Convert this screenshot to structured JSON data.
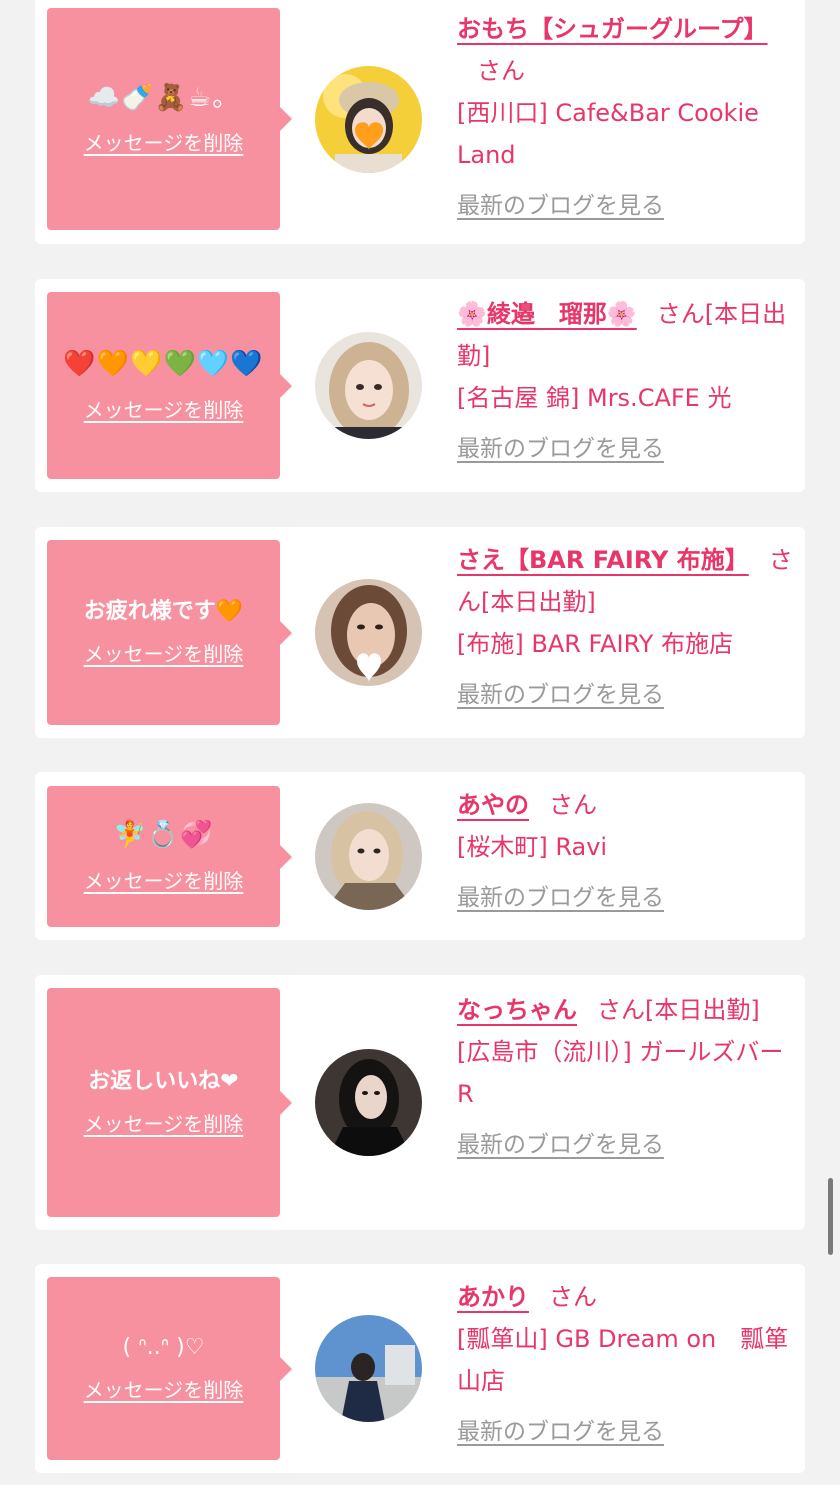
{
  "delete_label": "メッセージを削除",
  "blog_label": "最新のブログを見る",
  "accent_color": "#e8366a",
  "bubble_color": "#f7909f",
  "cards": [
    {
      "message": "☁️🍼🧸☕。",
      "name": "おもち【シュガーグループ】",
      "suffix": "さん",
      "shop": "[西川口] Cafe&Bar Cookie Land"
    },
    {
      "message": "❤️🧡💛💚🩵💙",
      "name": "🌸綾邉　瑠那🌸",
      "suffix": "さん[本日出勤]",
      "shop": "[名古屋 錦] Mrs.CAFE 光"
    },
    {
      "message": "お疲れ様です🧡",
      "name": "さえ【BAR FAIRY 布施】",
      "suffix": "さん[本日出勤]",
      "shop": "[布施] BAR FAIRY 布施店"
    },
    {
      "message": "🧚💍💞",
      "name": "あやの",
      "suffix": "さん",
      "shop": "[桜木町] Ravi"
    },
    {
      "message": "お返しいいね❤",
      "name": "なっちゃん",
      "suffix": "さん[本日出勤]",
      "shop": "[広島市（流川）] ガールズバーR"
    },
    {
      "message": "( ᐢ..ᐢ )♡",
      "name": "あかり",
      "suffix": "さん",
      "shop": "[瓢箪山] GB Dream on　瓢箪山店"
    }
  ]
}
